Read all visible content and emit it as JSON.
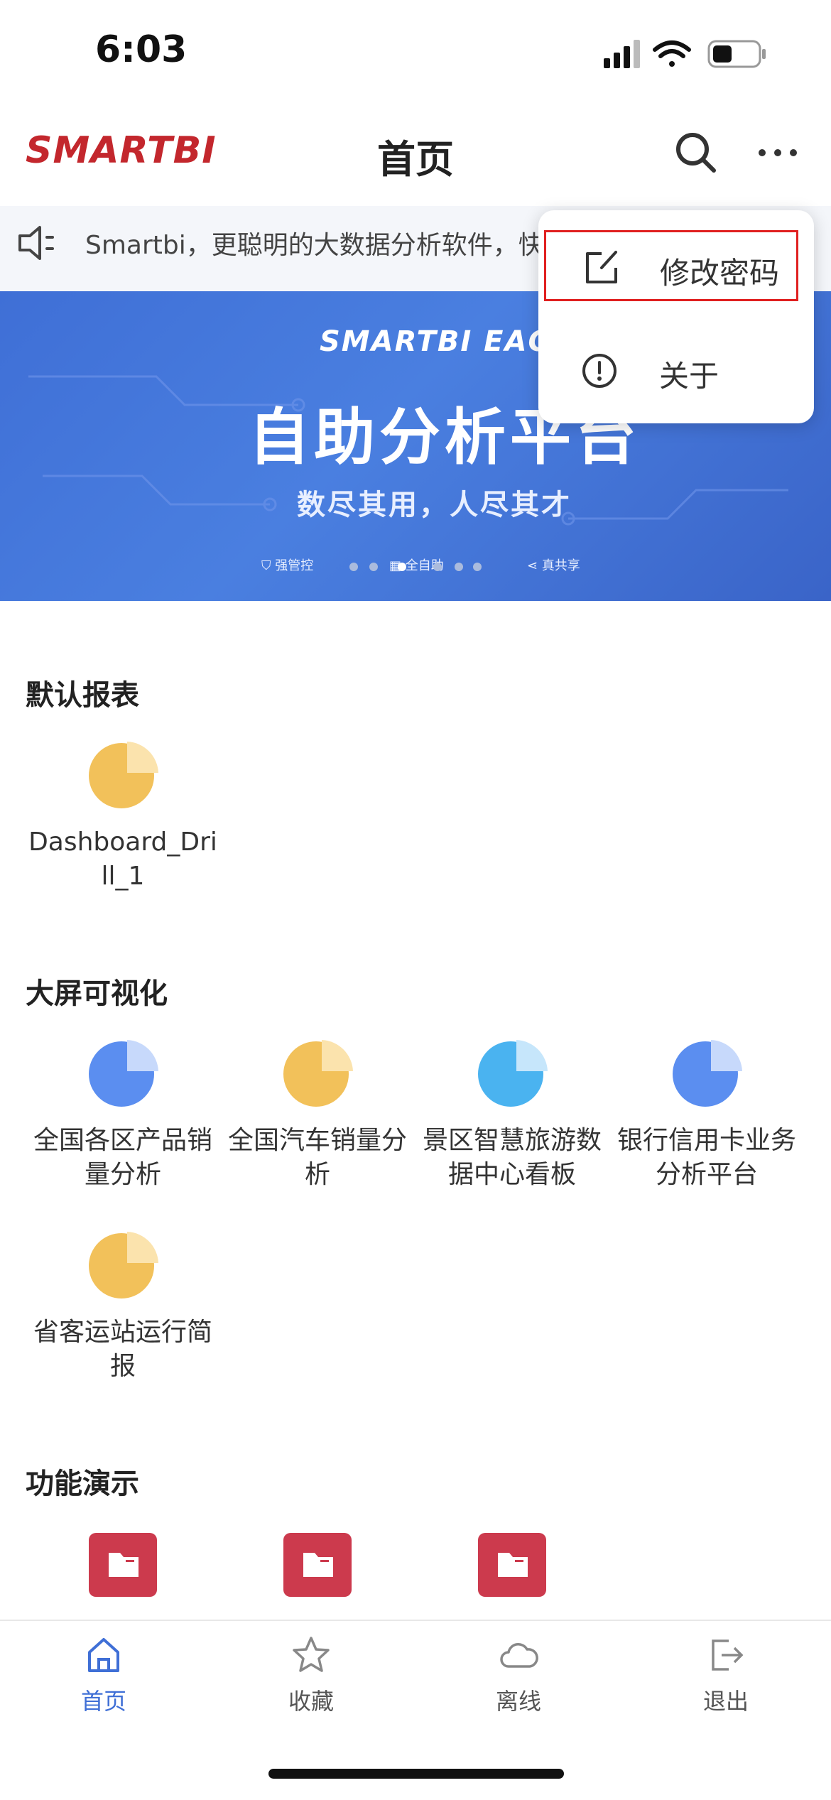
{
  "status_bar": {
    "time": "6:03"
  },
  "header": {
    "logo": "SMARTBI",
    "title": "首页"
  },
  "notice": {
    "text": "Smartbi，更聪明的大数据分析软件，快"
  },
  "banner": {
    "brand": "SMARTBI  EAGLE",
    "title": "自助分析平台",
    "subtitle": "数尽其用，人尽其才",
    "tags": [
      "强管控",
      "全自助",
      "真共享"
    ]
  },
  "sections": [
    {
      "title": "默认报表",
      "items": [
        {
          "label": "Dashboard_Drill_1",
          "icon": "pie-chart-yellow-icon"
        }
      ]
    },
    {
      "title": "大屏可视化",
      "items": [
        {
          "label": "全国各区产品销量分析",
          "icon": "pie-chart-blue-icon"
        },
        {
          "label": "全国汽车销量分析",
          "icon": "pie-chart-yellow-icon"
        },
        {
          "label": "景区智慧旅游数据中心看板",
          "icon": "pie-chart-cyan-icon"
        },
        {
          "label": "银行信用卡业务分析平台",
          "icon": "pie-chart-blue-icon"
        },
        {
          "label": "省客运站运行简报",
          "icon": "pie-chart-yellow-icon"
        }
      ]
    },
    {
      "title": "功能演示",
      "items": [
        {
          "label": "",
          "icon": "folder-icon"
        },
        {
          "label": "",
          "icon": "folder-icon"
        },
        {
          "label": "",
          "icon": "folder-icon"
        }
      ]
    }
  ],
  "menu": {
    "items": [
      {
        "label": "修改密码",
        "icon": "edit-icon",
        "highlighted": true
      },
      {
        "label": "关于",
        "icon": "info-icon",
        "highlighted": false
      }
    ]
  },
  "tabbar": {
    "tabs": [
      {
        "label": "首页",
        "icon": "home-icon",
        "active": true
      },
      {
        "label": "收藏",
        "icon": "star-icon",
        "active": false
      },
      {
        "label": "离线",
        "icon": "cloud-icon",
        "active": false
      },
      {
        "label": "退出",
        "icon": "logout-icon",
        "active": false
      }
    ]
  },
  "colors": {
    "brand": "#c3272d",
    "accent": "#3f6fd6",
    "highlight_border": "#e02020",
    "folder": "#cc3a4d"
  }
}
